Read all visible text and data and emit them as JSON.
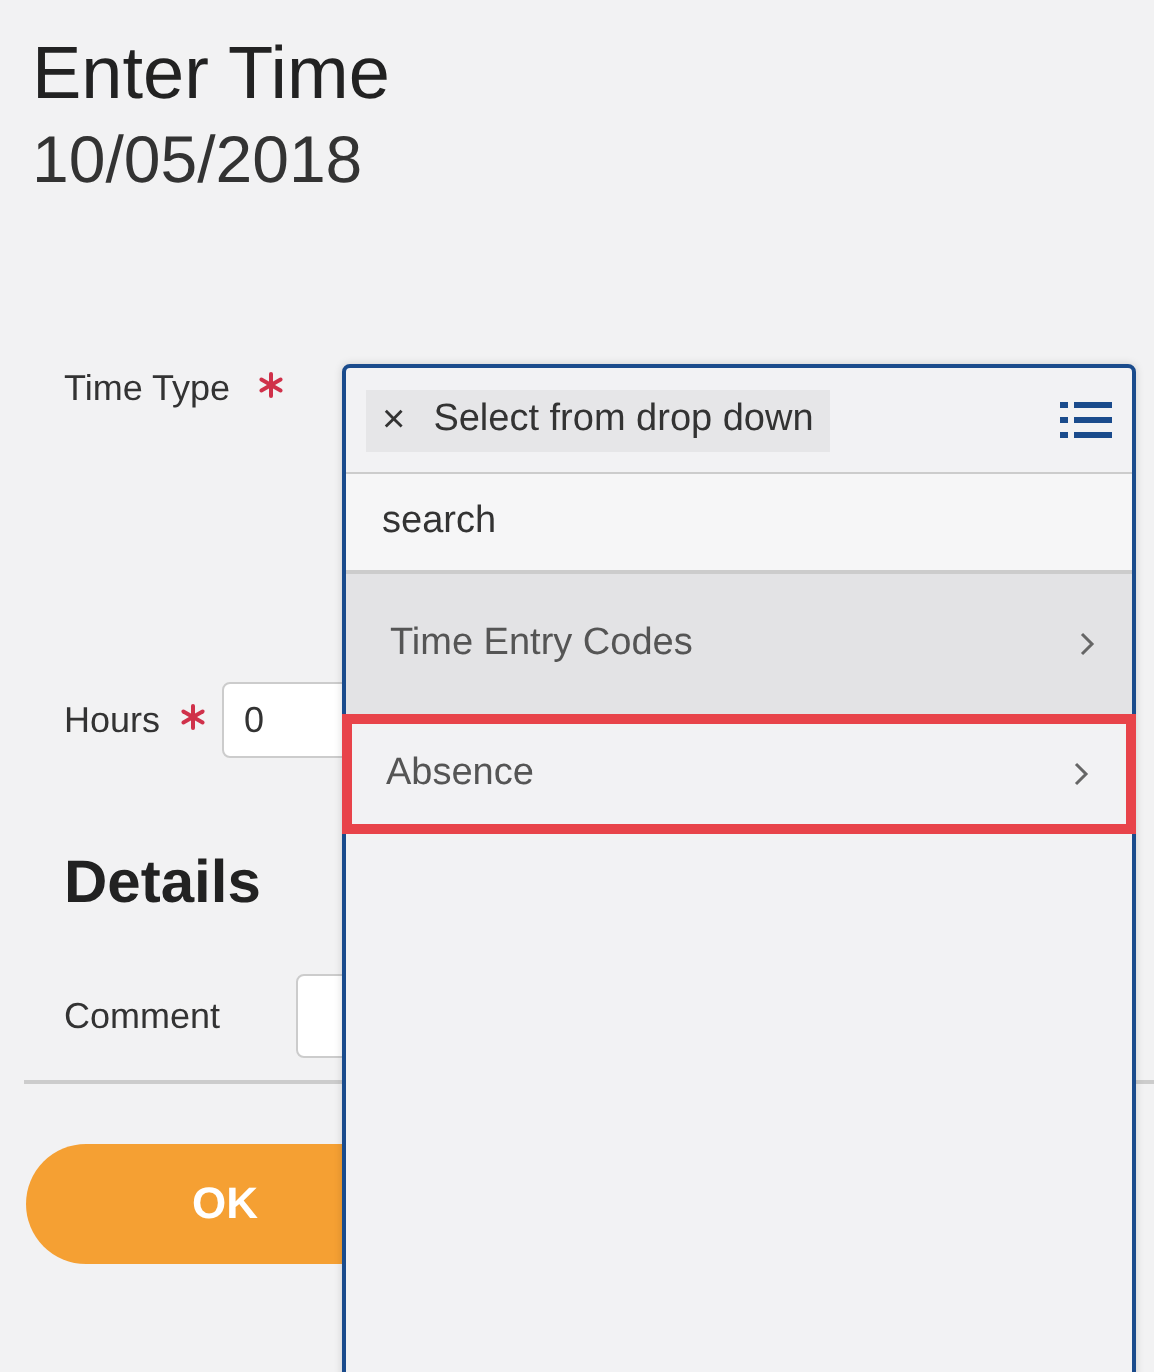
{
  "title": "Enter Time",
  "date": "10/05/2018",
  "fields": [
    {
      "label": "Time Type",
      "required": true,
      "kind": "select"
    },
    {
      "label": "Hours",
      "required": true,
      "kind": "number",
      "value": "0"
    }
  ],
  "details": {
    "heading": "Details",
    "comment_label": "Comment"
  },
  "ok_button": "OK",
  "dropdown": {
    "chip": {
      "remove": "×",
      "label": "Select from drop down"
    },
    "search": {
      "placeholder": "search"
    },
    "items": [
      {
        "label": "Time Entry Codes",
        "hovered": true,
        "selected": false
      },
      {
        "label": "Absence",
        "hovered": false,
        "selected": true
      }
    ]
  }
}
